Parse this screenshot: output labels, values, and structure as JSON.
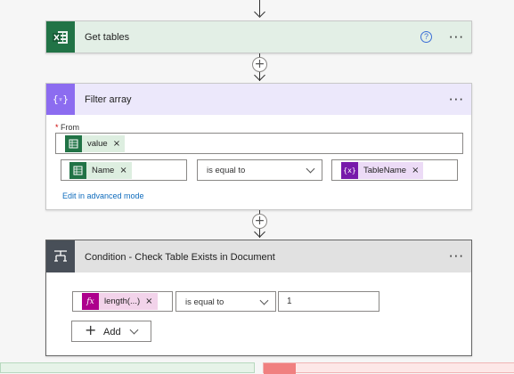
{
  "get_tables": {
    "title": "Get tables",
    "help_icon": "question-circle-icon",
    "more_label": "···",
    "header_color": "#e3efe6",
    "icon_color": "#217346"
  },
  "filter_array": {
    "title": "Filter array",
    "more_label": "···",
    "header_color": "#ece8fb",
    "icon_color": "#8c6cf0",
    "from_required": "*",
    "from_label": "From",
    "from_token": "value",
    "left_token": "Name",
    "operator": "is equal to",
    "right_token": "TableName",
    "advanced_link": "Edit in advanced mode",
    "token_color_excel": "#ddeee0",
    "token_color_variable": "#ecdbf6"
  },
  "condition": {
    "title": "Condition - Check Table Exists in Document",
    "more_label": "···",
    "header_color": "#e1e1e1",
    "icon_color": "#484f58",
    "left_token": "length(...)",
    "operator": "is equal to",
    "right_value": "1",
    "add_label": "Add",
    "token_color_expression": "#f2d3ea",
    "expression_icon_color": "#ad008c"
  },
  "branches": {
    "yes_color": "#e6f3e8",
    "no_color": "#fde7e7",
    "no_icon_color": "#f08080"
  },
  "token_remove": "×",
  "plus_label": "+"
}
